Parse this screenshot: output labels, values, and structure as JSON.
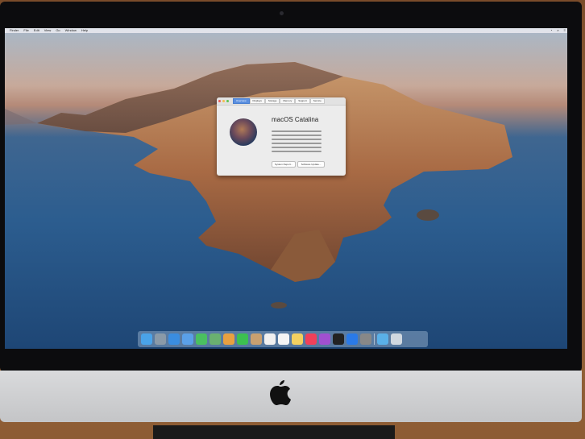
{
  "menubar": {
    "items": [
      "Finder",
      "File",
      "Edit",
      "View",
      "Go",
      "Window",
      "Help"
    ]
  },
  "about_window": {
    "tabs": [
      "Overview",
      "Displays",
      "Storage",
      "Memory",
      "Support",
      "Service"
    ],
    "title": "macOS Catalina",
    "buttons": [
      "System Report...",
      "Software Update..."
    ]
  },
  "dock": {
    "icons": [
      "finder-icon",
      "launchpad-icon",
      "safari-icon",
      "mail-icon",
      "messages-icon",
      "maps-icon",
      "photos-icon",
      "facetime-icon",
      "contacts-icon",
      "calendar-icon",
      "reminders-icon",
      "notes-icon",
      "music-icon",
      "podcasts-icon",
      "tv-icon",
      "app-store-icon",
      "system-preferences-icon",
      "downloads-folder-icon",
      "trash-icon"
    ],
    "colors": [
      "#4aa3e8",
      "#8a9aa8",
      "#3a8de0",
      "#5aa0e8",
      "#4ac060",
      "#6ab070",
      "#e8a040",
      "#3cc050",
      "#c8a070",
      "#f0f0f0",
      "#f4f4f4",
      "#f2d060",
      "#f0405a",
      "#a050d0",
      "#222222",
      "#2a7ae8",
      "#888888",
      "#5ab0e8",
      "#d0d8e0"
    ]
  },
  "colors": {
    "bezel": "#0c0c0e",
    "chin": "#d0d1d3",
    "accent_tab": "#5a8fe0"
  }
}
